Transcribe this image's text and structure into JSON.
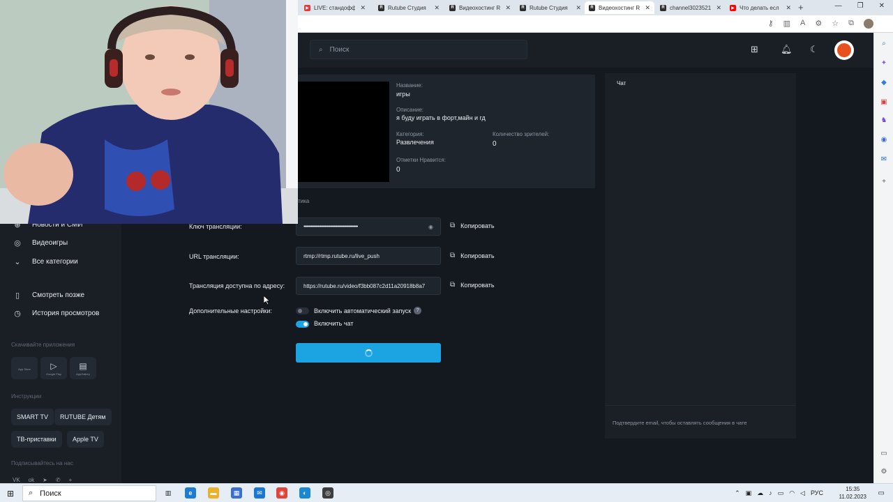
{
  "browser": {
    "tabs": [
      {
        "label": "LIVE: стандофф",
        "icon_color": "#e53935",
        "icon_text": "▶"
      },
      {
        "label": "Rutube Студия",
        "icon_color": "#2d2d2d",
        "icon_text": "R"
      },
      {
        "label": "Видеохостинг R",
        "icon_color": "#2d2d2d",
        "icon_text": "R"
      },
      {
        "label": "Rutube Студия",
        "icon_color": "#2d2d2d",
        "icon_text": "R"
      },
      {
        "label": "Видеохостинг R",
        "icon_color": "#2d2d2d",
        "icon_text": "R",
        "active": true
      },
      {
        "label": "channel3023521",
        "icon_color": "#2d2d2d",
        "icon_text": "R"
      },
      {
        "label": "Что делать есл",
        "icon_color": "#ff0000",
        "icon_text": "▶"
      }
    ],
    "new_tab": "+",
    "win_minimize": "—",
    "win_maximize": "❐",
    "win_close": "✕"
  },
  "header": {
    "search_placeholder": "Поиск",
    "icons": [
      "upload-icon",
      "bell-icon",
      "moon-icon"
    ]
  },
  "sidebar": {
    "items": [
      {
        "label": "Новости и СМИ",
        "icon": "globe-icon",
        "glyph": "⊕"
      },
      {
        "label": "Видеоигры",
        "icon": "gamepad-icon",
        "glyph": "◎"
      },
      {
        "label": "Все категории",
        "icon": "chevron-down-icon",
        "glyph": "⌄"
      },
      {
        "label": "Смотреть позже",
        "icon": "bookmark-icon",
        "glyph": "▯"
      },
      {
        "label": "История просмотров",
        "icon": "history-icon",
        "glyph": "◷"
      }
    ],
    "apps_heading": "Скачивайте приложения",
    "apps": [
      {
        "label": "App Store",
        "glyph": ""
      },
      {
        "label": "Google Play",
        "glyph": "▷"
      },
      {
        "label": "AppGallery",
        "glyph": "▤"
      }
    ],
    "instructions_heading": "Инструкции",
    "instructions": [
      "SMART TV",
      "RUTUBE Детям",
      "ТВ-приставки",
      "Apple TV"
    ],
    "subscribe_heading": "Подписывайтесь на нас",
    "socials": [
      "vk",
      "ok",
      "tg",
      "vb",
      "+"
    ]
  },
  "stream": {
    "name_label": "Название:",
    "name_value": "игры",
    "desc_label": "Описание:",
    "desc_value": "я буду играть в форт,майн и гд",
    "category_label": "Категория:",
    "category_value": "Развлечения",
    "viewers_label": "Количество зрителей:",
    "viewers_value": "0",
    "likes_label": "Отметки Нравится:",
    "likes_value": "0",
    "section_tab": "тика",
    "key_label": "Ключ трансляции:",
    "key_value": "••••••••••••••••••••••••••••••••••••••••••••••••••••••",
    "url_label": "URL трансляции:",
    "url_value": "rtmp://rtmp.rutube.ru/live_push",
    "address_label": "Трансляция доступна по адресу:",
    "address_value": "https://rutube.ru/video/f3bb087c2d11a20918b8a7",
    "copy_label": "Копировать",
    "extra_label": "Дополнительные настройки:",
    "autostart_label": "Включить автоматический запуск",
    "autostart_on": false,
    "chat_label": "Включить чат",
    "chat_on": true
  },
  "chat": {
    "title": "Чат",
    "note": "Подтвердите email, чтобы оставлять сообщения в чате"
  },
  "taskbar": {
    "search_label": "Поиск",
    "lang": "РУС",
    "time": "15:35",
    "date": "11.02.2023"
  },
  "colors": {
    "accent": "#1ba3e2",
    "background": "#14191f",
    "panel": "#1f252d"
  }
}
